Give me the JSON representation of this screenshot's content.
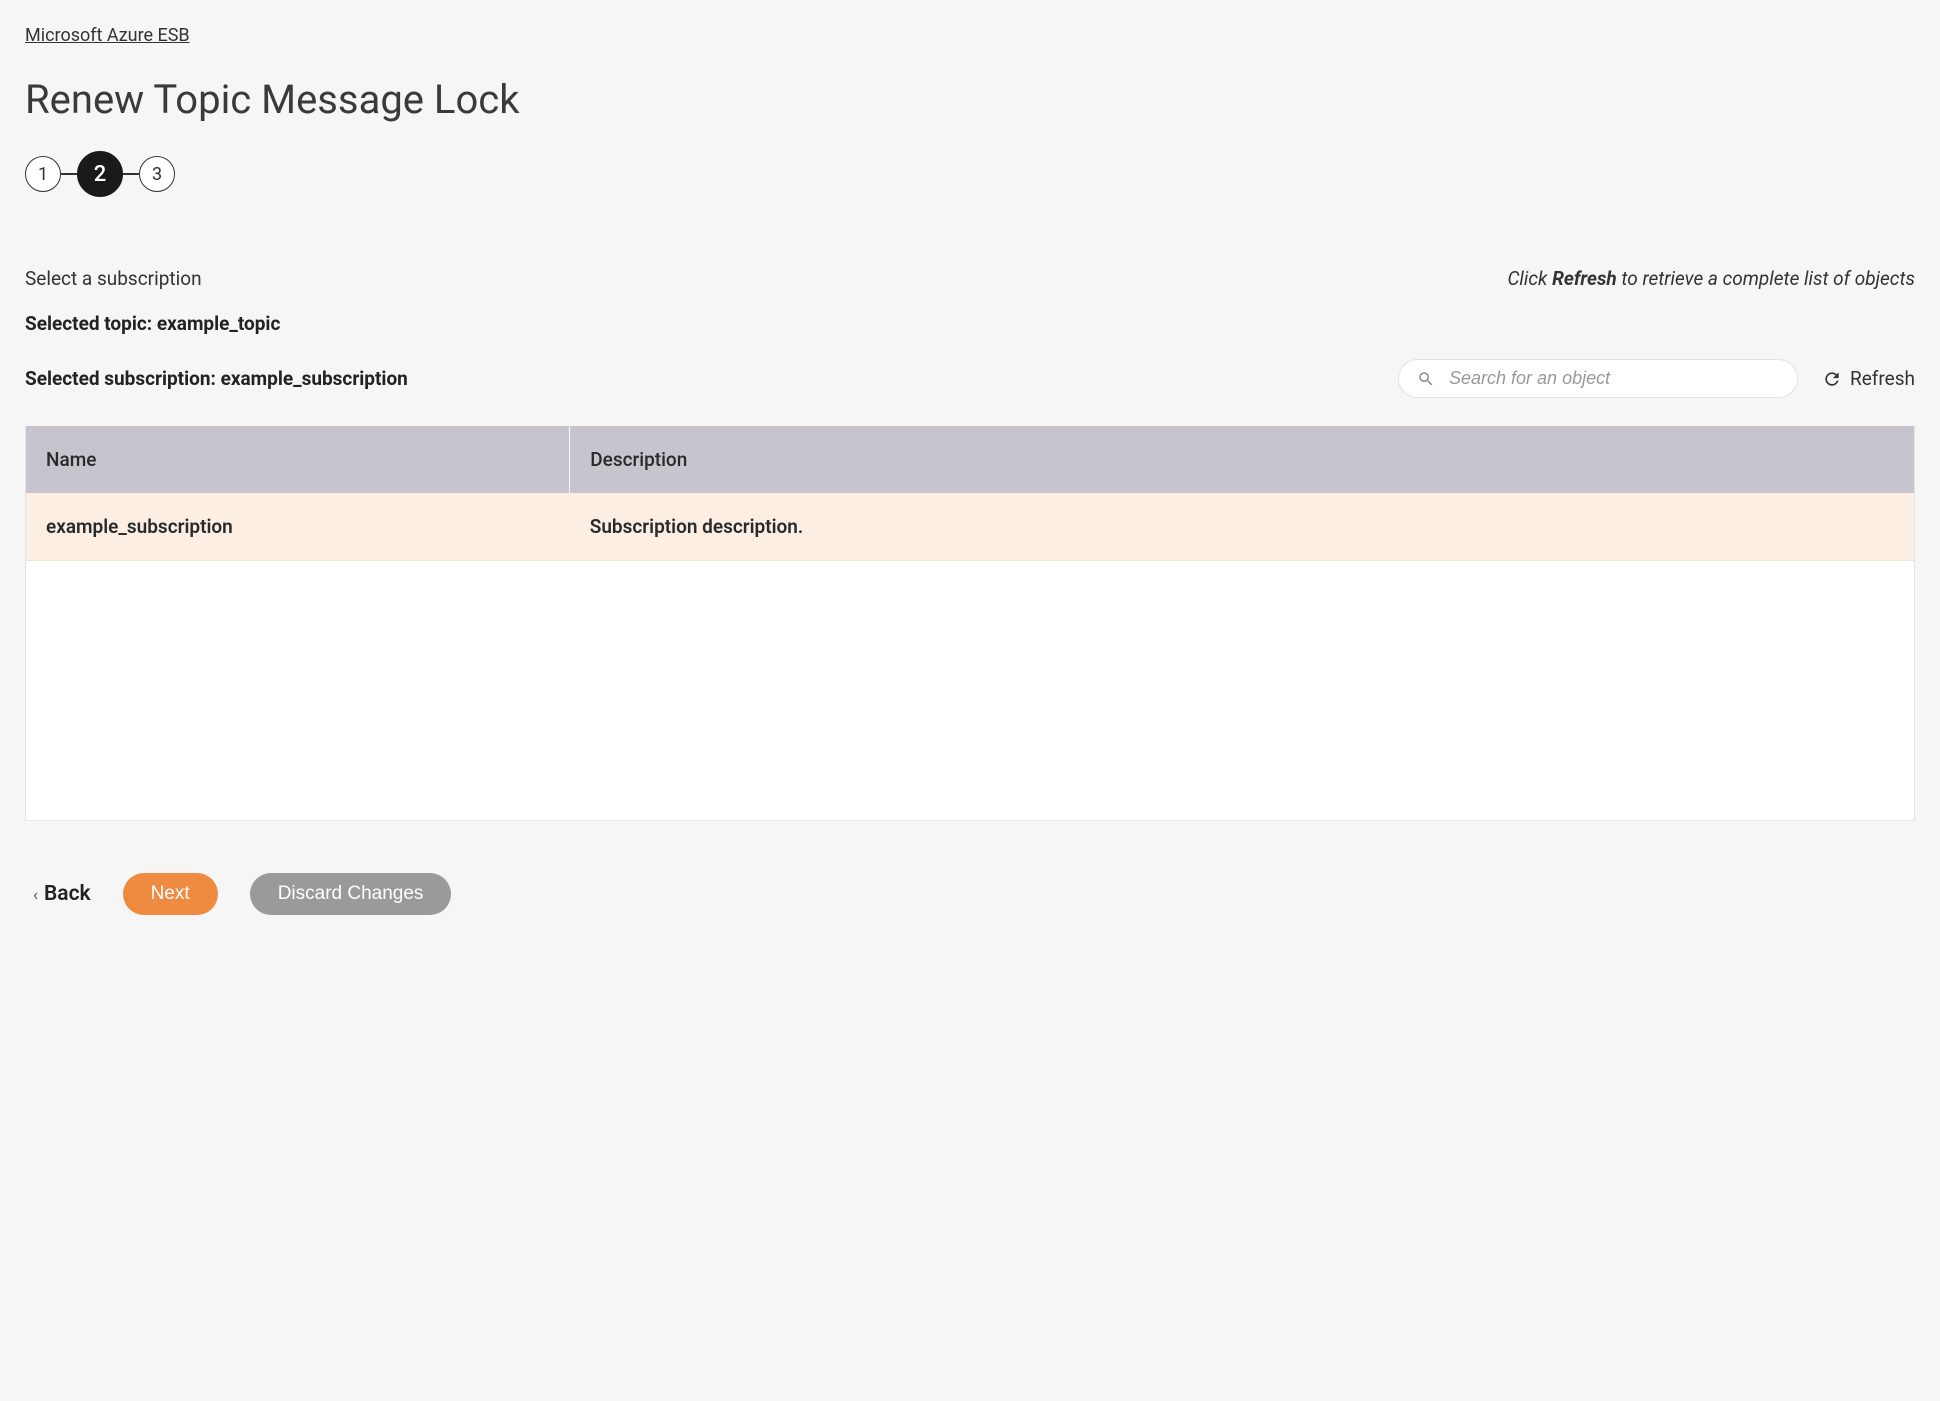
{
  "breadcrumb": {
    "label": "Microsoft Azure ESB"
  },
  "page": {
    "title": "Renew Topic Message Lock"
  },
  "stepper": {
    "steps": [
      "1",
      "2",
      "3"
    ],
    "active_index": 1
  },
  "section": {
    "select_label": "Select a subscription",
    "hint_prefix": "Click ",
    "hint_bold": "Refresh",
    "hint_suffix": " to retrieve a complete list of objects",
    "selected_topic_label": "Selected topic: example_topic",
    "selected_subscription_label": "Selected subscription: example_subscription"
  },
  "search": {
    "placeholder": "Search for an object"
  },
  "refresh": {
    "label": "Refresh"
  },
  "table": {
    "headers": {
      "name": "Name",
      "description": "Description"
    },
    "rows": [
      {
        "name": "example_subscription",
        "description": "Subscription description."
      }
    ]
  },
  "footer": {
    "back": "Back",
    "next": "Next",
    "discard": "Discard Changes"
  }
}
